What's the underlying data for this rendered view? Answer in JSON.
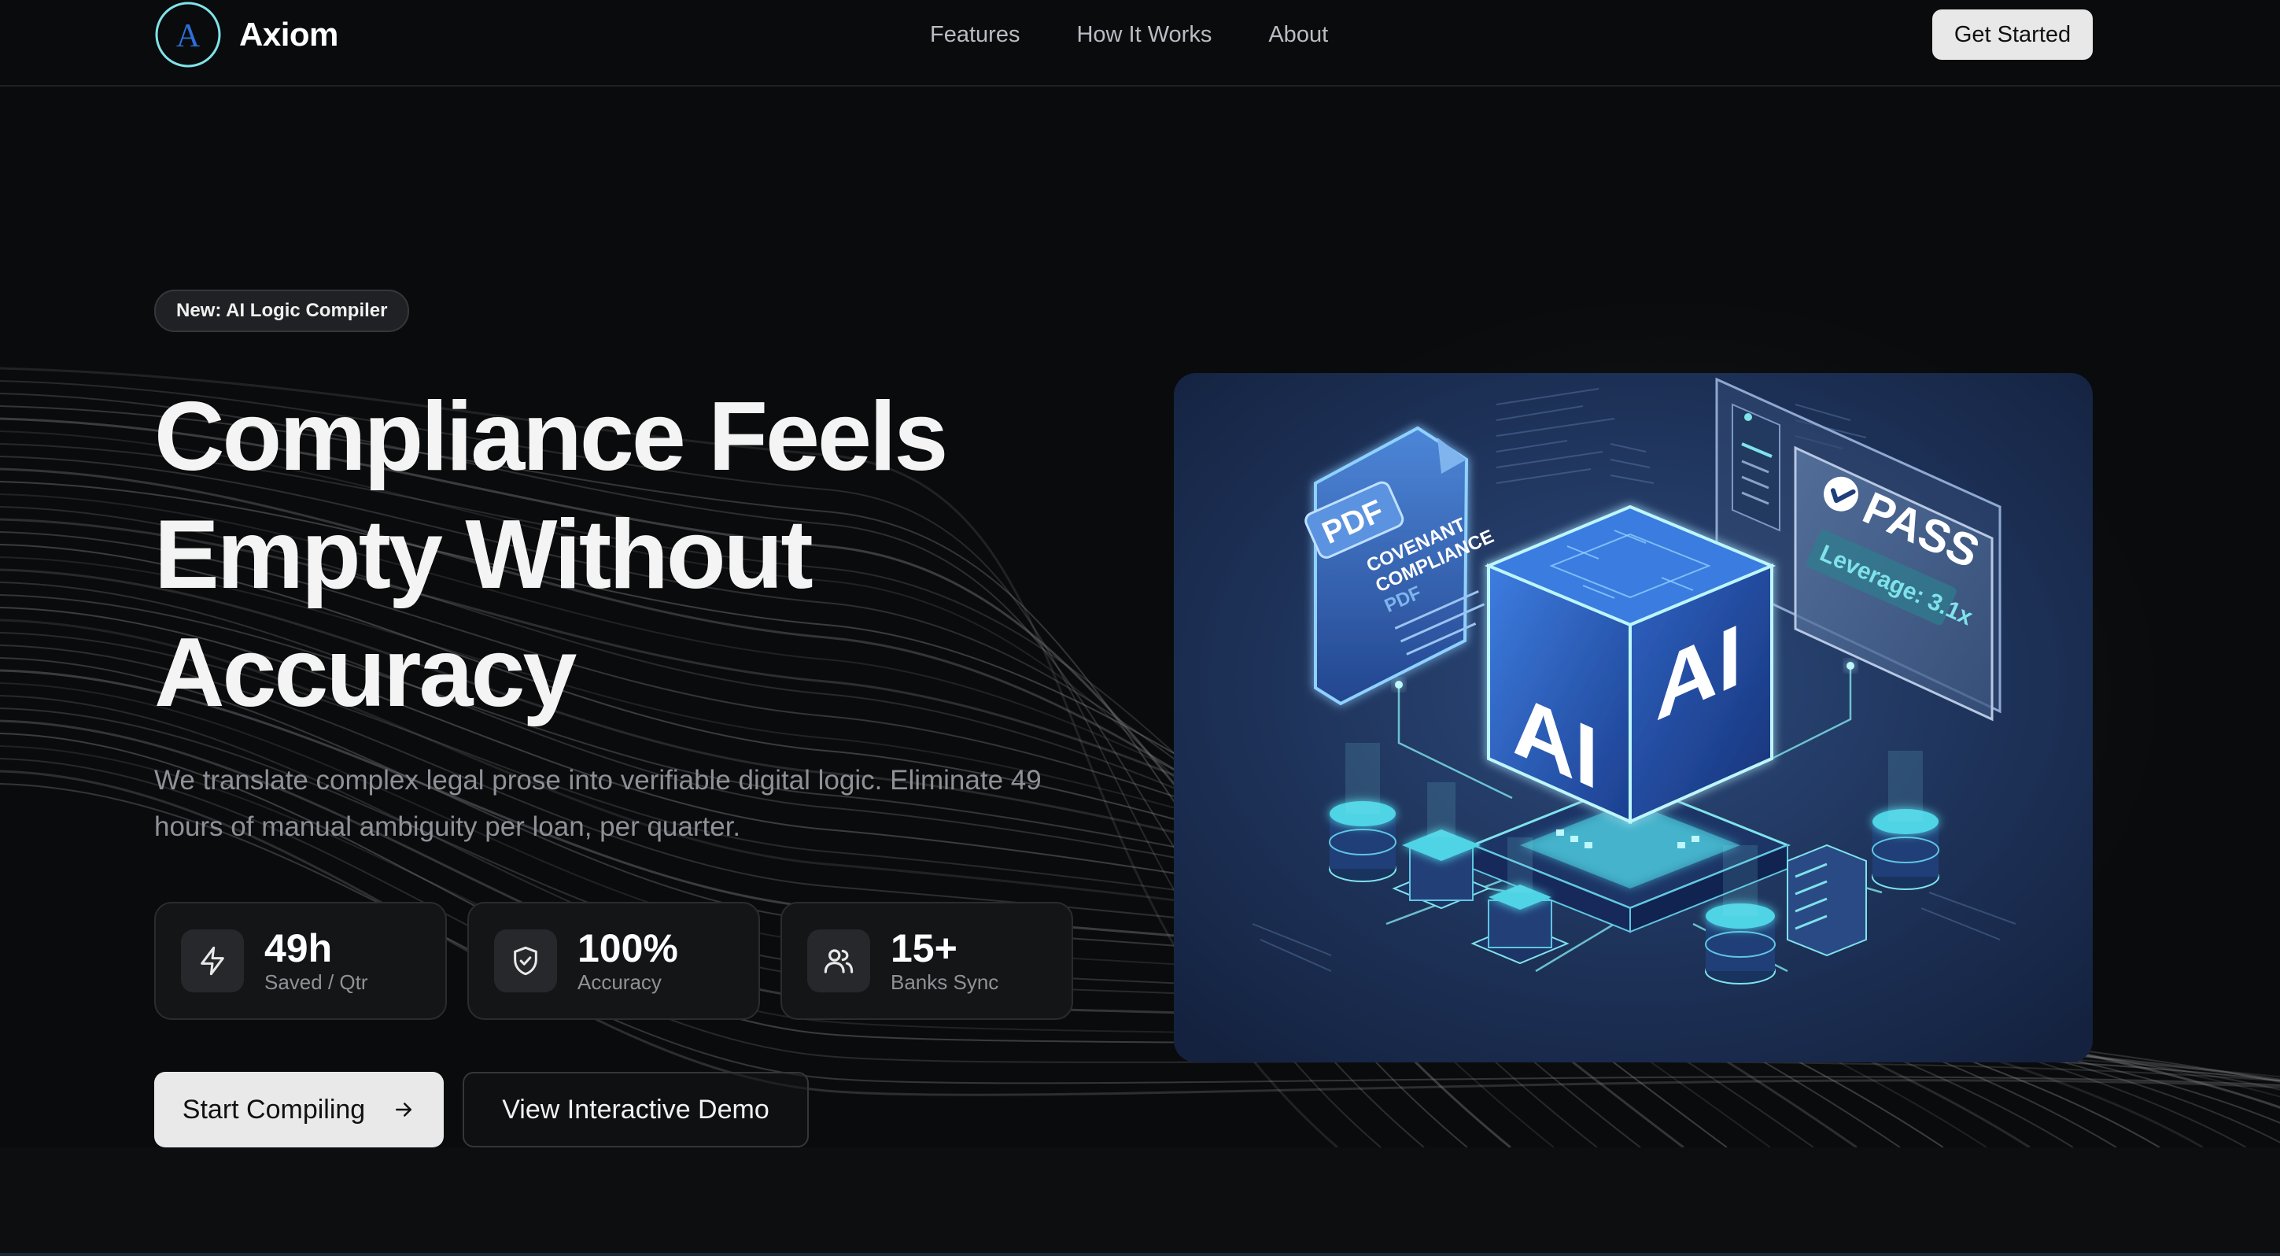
{
  "brand": {
    "name": "Axiom",
    "logo_letter": "A"
  },
  "nav": {
    "links": [
      "Features",
      "How It Works",
      "About"
    ],
    "cta": "Get Started"
  },
  "hero": {
    "badge": "New: AI Logic Compiler",
    "title_lines": [
      "Compliance Feels",
      "Empty Without",
      "Accuracy"
    ],
    "subtitle": "We translate complex legal prose into verifiable digital logic. Eliminate 49 hours of manual ambiguity per loan, per quarter.",
    "stats": [
      {
        "icon": "lightning-icon",
        "value": "49h",
        "label": "Saved / Qtr"
      },
      {
        "icon": "shield-check-icon",
        "value": "100%",
        "label": "Accuracy"
      },
      {
        "icon": "users-icon",
        "value": "15+",
        "label": "Banks Sync"
      }
    ],
    "primary_cta": "Start Compiling",
    "secondary_cta": "View Interactive Demo"
  },
  "illustration": {
    "doc_tag": "PDF",
    "doc_lines": [
      "COVENANT",
      "COMPLIANCE",
      "PDF"
    ],
    "cube_label": "AI",
    "result_label": "PASS",
    "result_detail": "Leverage: 3.1x"
  },
  "colors": {
    "background": "#0a0b0c",
    "accent": "#5fe6f0",
    "card": "#141516",
    "illustration_bg": "#22375e"
  }
}
